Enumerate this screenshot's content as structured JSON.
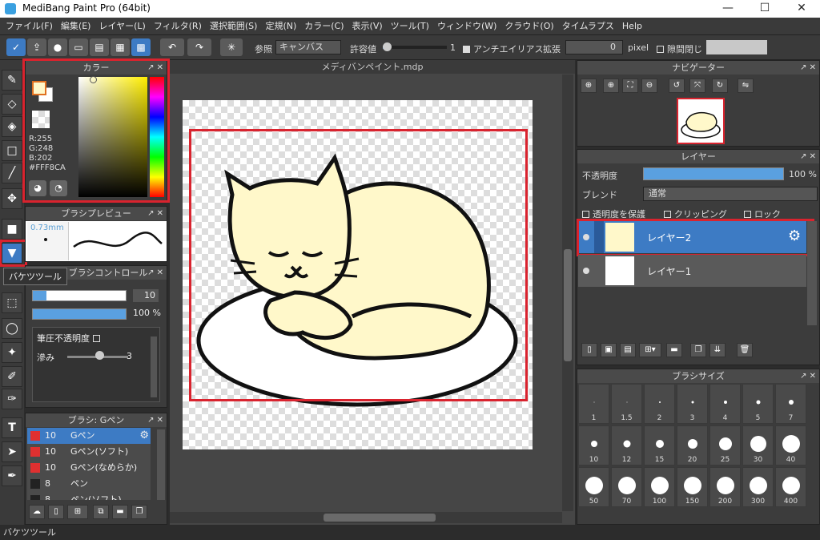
{
  "window": {
    "title": "MediBang Paint Pro (64bit)",
    "minimize": "—",
    "maximize": "☐",
    "close": "✕"
  },
  "menu": [
    "ファイル(F)",
    "編集(E)",
    "レイヤー(L)",
    "フィルタ(R)",
    "選択範囲(S)",
    "定規(N)",
    "カラー(C)",
    "表示(V)",
    "ツール(T)",
    "ウィンドウ(W)",
    "クラウド(O)",
    "タイムラプス",
    "Help"
  ],
  "toolbar": {
    "ref_label": "参照",
    "ref_value": "キャンバス",
    "tolerance_label": "許容値",
    "tolerance_value": "1",
    "tolerance_fraction": 0.02,
    "antialias_label": "アンチエイリアス",
    "expand_label": "拡張",
    "expand_value": "0",
    "expand_unit": "pixel",
    "gap_close_label": "隙間閉じ"
  },
  "color_panel": {
    "title": "カラー",
    "r": "R:255",
    "g": "G:248",
    "b": "B:202",
    "hex": "#FFF8CA",
    "fg_color": "#fff8ca"
  },
  "brush_preview": {
    "title": "ブラシプレビュー",
    "size": "0.73mm"
  },
  "brush_control": {
    "title": "ブラシコントロール",
    "size_value": "10",
    "opacity_value": "100 %",
    "pressure_opacity_label": "筆圧不透明度",
    "blur_label": "滲み",
    "blur_value": "3",
    "size_fraction": 0.15,
    "opacity_fraction": 1.0,
    "blur_fraction": 0.5
  },
  "tooltip": "バケツツール",
  "brush_list": {
    "title": "ブラシ: Gペン",
    "items": [
      {
        "size": "10",
        "name": "Gペン",
        "color": "#e03030",
        "selected": true
      },
      {
        "size": "10",
        "name": "Gペン(ソフト)",
        "color": "#e03030"
      },
      {
        "size": "10",
        "name": "Gペン(なめらか)",
        "color": "#e03030"
      },
      {
        "size": "8",
        "name": "ペン",
        "color": "#222222"
      },
      {
        "size": "8",
        "name": "ペン(ソフト)",
        "color": "#222222"
      }
    ]
  },
  "canvas": {
    "tab_title": "メディバンペイント.mdp"
  },
  "navigator": {
    "title": "ナビゲーター"
  },
  "layer_panel": {
    "title": "レイヤー",
    "opacity_label": "不透明度",
    "opacity_value": "100 %",
    "opacity_fraction": 1.0,
    "blend_label": "ブレンド",
    "blend_value": "通常",
    "protect_alpha": "透明度を保護",
    "clipping": "クリッピング",
    "lock": "ロック",
    "layers": [
      {
        "name": "レイヤー2",
        "selected": true
      },
      {
        "name": "レイヤー1",
        "selected": false
      }
    ]
  },
  "brush_size": {
    "title": "ブラシサイズ",
    "sizes": [
      "1",
      "1.5",
      "2",
      "3",
      "4",
      "5",
      "7",
      "10",
      "12",
      "15",
      "20",
      "25",
      "30",
      "40",
      "50",
      "70",
      "100",
      "150",
      "200",
      "300",
      "400"
    ]
  },
  "status": "バケツツール",
  "colors": {
    "accent": "#3d7bc4",
    "highlight_red": "#d9232e",
    "cat_fill": "#fff8ca"
  }
}
